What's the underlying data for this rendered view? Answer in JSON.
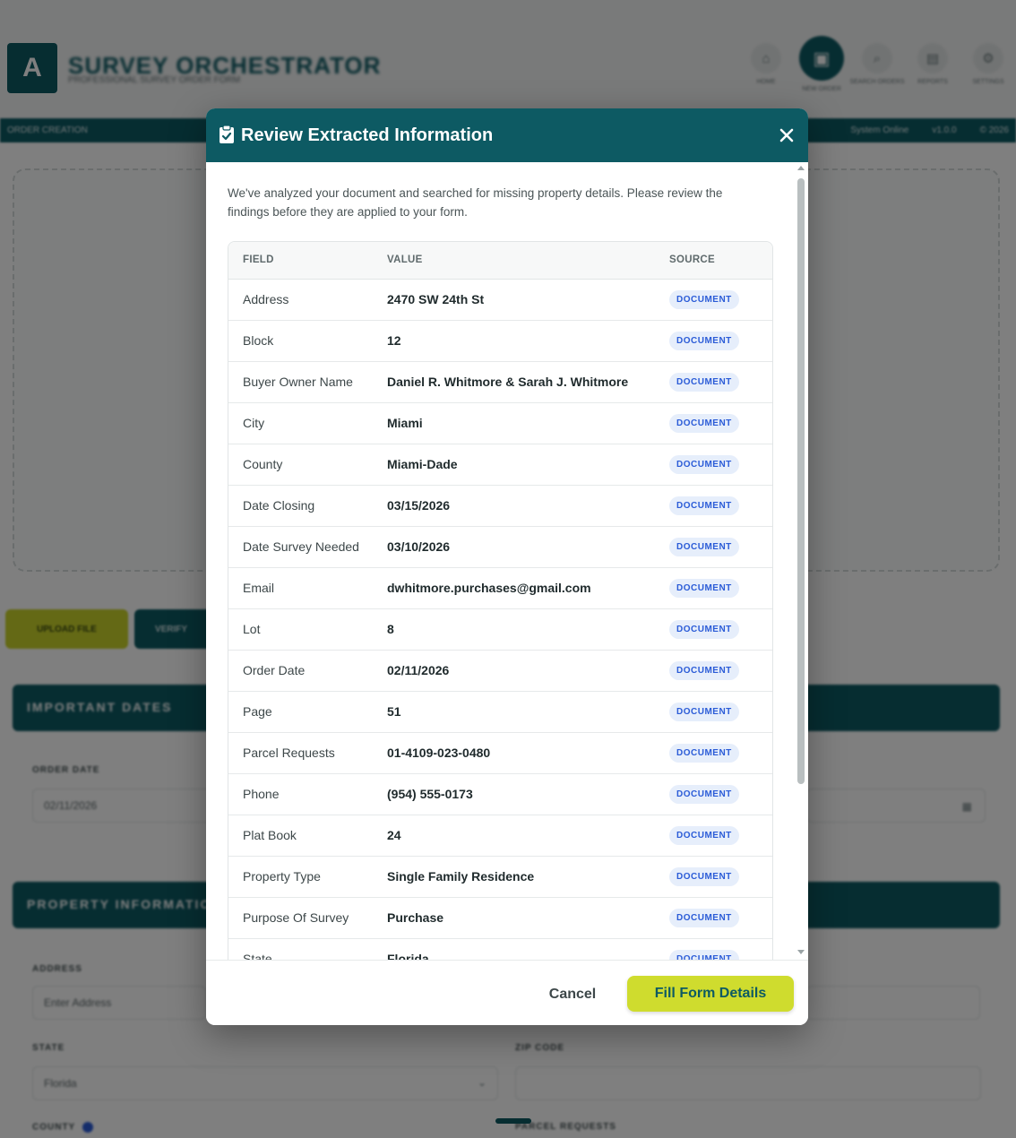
{
  "app": {
    "title": "SURVEY ORCHESTRATOR",
    "subtitle": "PROFESSIONAL SURVEY ORDER FORM",
    "nav": [
      {
        "label": "HOME",
        "icon": "home-icon"
      },
      {
        "label": "NEW ORDER",
        "icon": "clipboard-icon"
      },
      {
        "label": "SEARCH ORDERS",
        "icon": "search-icon"
      },
      {
        "label": "REPORTS",
        "icon": "document-icon"
      },
      {
        "label": "SETTINGS",
        "icon": "gear-icon"
      }
    ],
    "subbar_left": "ORDER CREATION",
    "subbar_right": [
      "System Online",
      "v1.0.0",
      "© 2026"
    ],
    "buttons": {
      "primary": "UPLOAD FILE",
      "secondary": "VERIFY"
    },
    "sections": {
      "dates": "IMPORTANT DATES",
      "property": "PROPERTY INFORMATION"
    },
    "labels": {
      "order_date": "ORDER DATE",
      "address": "ADDRESS",
      "state": "STATE",
      "zip_code": "ZIP CODE",
      "county": "COUNTY",
      "parcel_requests": "PARCEL REQUESTS"
    },
    "values": {
      "order_date": "02/11/2026",
      "address_placeholder": "Enter Address",
      "state": "Florida"
    }
  },
  "modal": {
    "title": "Review Extracted Information",
    "intro": "We've analyzed your document and searched for missing property details. Please review the findings before they are applied to your form.",
    "columns": {
      "field": "FIELD",
      "value": "VALUE",
      "source": "SOURCE"
    },
    "rows": [
      {
        "field": "Address",
        "value": "2470 SW 24th St",
        "source": "DOCUMENT"
      },
      {
        "field": "Block",
        "value": "12",
        "source": "DOCUMENT"
      },
      {
        "field": "Buyer Owner Name",
        "value": "Daniel R. Whitmore & Sarah J. Whitmore",
        "source": "DOCUMENT"
      },
      {
        "field": "City",
        "value": "Miami",
        "source": "DOCUMENT"
      },
      {
        "field": "County",
        "value": "Miami-Dade",
        "source": "DOCUMENT"
      },
      {
        "field": "Date Closing",
        "value": "03/15/2026",
        "source": "DOCUMENT"
      },
      {
        "field": "Date Survey Needed",
        "value": "03/10/2026",
        "source": "DOCUMENT"
      },
      {
        "field": "Email",
        "value": "dwhitmore.purchases@gmail.com",
        "source": "DOCUMENT"
      },
      {
        "field": "Lot",
        "value": "8",
        "source": "DOCUMENT"
      },
      {
        "field": "Order Date",
        "value": "02/11/2026",
        "source": "DOCUMENT"
      },
      {
        "field": "Page",
        "value": "51",
        "source": "DOCUMENT"
      },
      {
        "field": "Parcel Requests",
        "value": "01-4109-023-0480",
        "source": "DOCUMENT"
      },
      {
        "field": "Phone",
        "value": "(954) 555-0173",
        "source": "DOCUMENT"
      },
      {
        "field": "Plat Book",
        "value": "24",
        "source": "DOCUMENT"
      },
      {
        "field": "Property Type",
        "value": "Single Family Residence",
        "source": "DOCUMENT"
      },
      {
        "field": "Purpose Of Survey",
        "value": "Purchase",
        "source": "DOCUMENT"
      },
      {
        "field": "State",
        "value": "Florida",
        "source": "DOCUMENT"
      }
    ],
    "cancel_label": "Cancel",
    "fill_label": "Fill Form Details"
  },
  "colors": {
    "header_teal": "#0d5a63",
    "accent_lime": "#cfdc2e",
    "badge_bg": "#e6eefb",
    "badge_text": "#2a5bd7"
  }
}
